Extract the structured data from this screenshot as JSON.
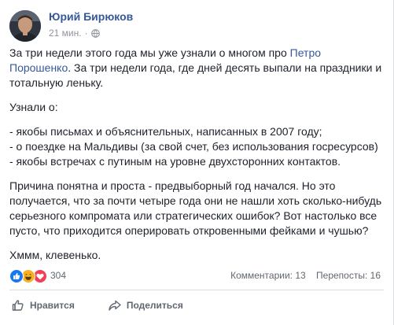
{
  "post": {
    "author": "Юрий Бирюков",
    "time": "21 мин.",
    "separator": "·",
    "privacy_icon": "globe-icon",
    "paragraphs": [
      {
        "before": "За три недели этого года мы уже узнали о многом про ",
        "link": "Петро Порошенко",
        "after": ". За три недели года, где дней десять выпали на праздники и тотальную леньку."
      }
    ],
    "known_intro": "Узнали о:",
    "known_items": [
      "- якобы письмах и объяснительных, написанных в 2007 году;",
      "- о поездке на Мальдивы (за свой счет, без использования госресурсов)",
      "- якобы встречах с путиным на уровне двухсторонних контактов."
    ],
    "reason": "Причина понятна и проста - предвыборный год начался. Но это получается, что за почти четыре года они не нашли хоть сколько-нибудь серьезного компромата или стратегических ошибок? Вот настолько все пусто, что приходится оперировать откровенными фейками и чушью?",
    "closing": "Хммм, клевенько."
  },
  "reactions": {
    "icons": [
      "like-reaction-icon",
      "haha-reaction-icon",
      "love-reaction-icon"
    ],
    "count": "304",
    "comments": "Комментарии: 13",
    "shares": "Перепосты: 16"
  },
  "actions": {
    "like": "Нравится",
    "share": "Поделиться"
  },
  "colors": {
    "link": "#365899",
    "text": "#1d2129",
    "muted": "#606770",
    "like_blue": "#1877f2",
    "haha_yellow": "#f7b125",
    "love_red": "#f33e58"
  }
}
